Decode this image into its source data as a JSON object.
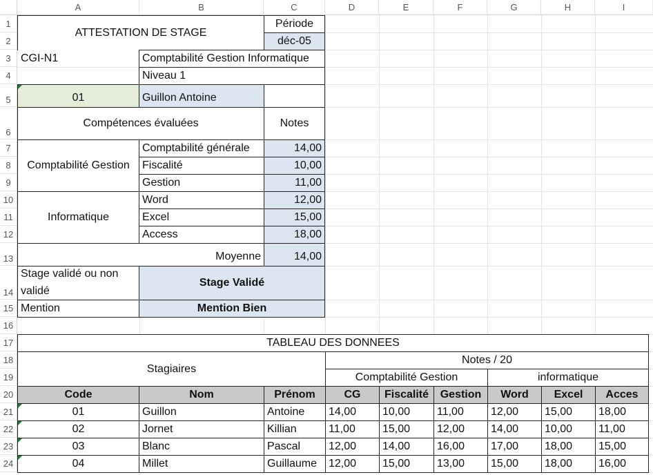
{
  "columns": [
    "A",
    "B",
    "C",
    "D",
    "E",
    "F",
    "G",
    "H",
    "I"
  ],
  "rows": [
    "1",
    "2",
    "3",
    "4",
    "5",
    "6",
    "7",
    "8",
    "9",
    "10",
    "11",
    "12",
    "13",
    "14",
    "15",
    "16",
    "17",
    "18",
    "19",
    "20",
    "21",
    "22",
    "23",
    "24"
  ],
  "attestation": {
    "title": "ATTESTATION DE STAGE",
    "periode_label": "Période",
    "periode_value": "déc-05",
    "code_classe": "CGI-N1",
    "formation": "Comptabilité Gestion Informatique",
    "niveau": "Niveau 1",
    "code_stagiaire": "01",
    "stagiaire": "Guillon Antoine",
    "competences_header": "Compétences évaluées",
    "notes_header": "Notes",
    "group1": "Comptabilité Gestion",
    "group2": "Informatique",
    "items": [
      {
        "label": "Comptabilité générale",
        "note": "14,00"
      },
      {
        "label": "Fiscalité",
        "note": "10,00"
      },
      {
        "label": "Gestion",
        "note": "11,00"
      },
      {
        "label": "Word",
        "note": "12,00"
      },
      {
        "label": "Excel",
        "note": "15,00"
      },
      {
        "label": "Access",
        "note": "18,00"
      }
    ],
    "moyenne_label": "Moyenne",
    "moyenne_value": "14,00",
    "validation_label": "Stage validé ou non validé",
    "validation_value": "Stage Validé",
    "mention_label": "Mention",
    "mention_value": "Mention Bien"
  },
  "tableau": {
    "title": "TABLEAU DES DONNEES",
    "stagiaires_label": "Stagiaires",
    "notes_label": "Notes / 20",
    "group1": "Comptabilité Gestion",
    "group2": "informatique",
    "headers": [
      "Code",
      "Nom",
      "Prénom",
      "CG",
      "Fiscalité",
      "Gestion",
      "Word",
      "Excel",
      "Acces"
    ],
    "rows": [
      [
        "01",
        "Guillon",
        "Antoine",
        "14,00",
        "10,00",
        "11,00",
        "12,00",
        "15,00",
        "18,00"
      ],
      [
        "02",
        "Jornet",
        "Killian",
        "11,00",
        "15,00",
        "12,00",
        "14,00",
        "10,00",
        "11,00"
      ],
      [
        "03",
        "Blanc",
        "Pascal",
        "12,00",
        "14,00",
        "16,00",
        "17,00",
        "18,00",
        "15,00"
      ],
      [
        "04",
        "Millet",
        "Guillaume",
        "12,00",
        "15,00",
        "13,00",
        "15,00",
        "18,00",
        "16,00"
      ]
    ]
  }
}
